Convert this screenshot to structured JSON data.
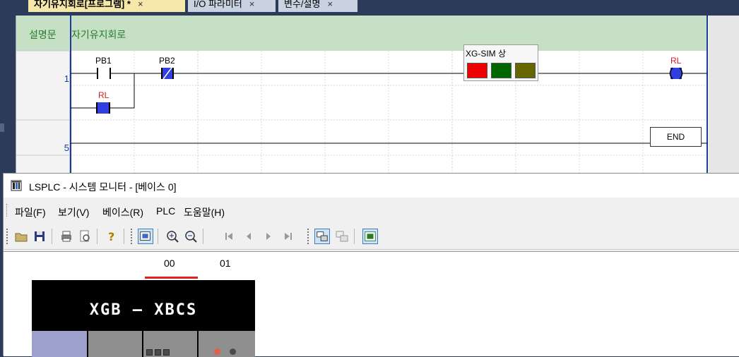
{
  "tabs": [
    {
      "label": "자기유지회로[프로그램] *",
      "active": true
    },
    {
      "label": "I/O 파라미터",
      "active": false
    },
    {
      "label": "변수/설명",
      "active": false
    }
  ],
  "tab_close_glyph": "×",
  "ladder": {
    "comment_label": "설명문",
    "comment_text": "자기유지회로",
    "rung1_number": "1",
    "rung2_number": "5",
    "contacts": [
      {
        "name": "PB1",
        "type": "NO contact",
        "state": "off"
      },
      {
        "name": "PB2",
        "type": "NC contact",
        "state": "on"
      },
      {
        "name": "RL",
        "type": "NO contact",
        "state": "on"
      }
    ],
    "coil": {
      "name": "RL",
      "state": "on"
    },
    "end_label": "END"
  },
  "sim_status": {
    "title": "XG-SIM 상",
    "leds": [
      "#ee0000",
      "#006600",
      "#666600"
    ]
  },
  "system_monitor": {
    "title": "LSPLC - 시스템 모니터 - [베이스 0]",
    "app_icon": "system-monitor-icon",
    "menu": [
      "파일(F)",
      "보기(V)",
      "베이스(R)",
      "PLC",
      "도움말(H)"
    ],
    "toolbar_icons": [
      "open-folder-icon",
      "save-icon",
      "print-icon",
      "print-preview-icon",
      "help-icon",
      "system-view-icon",
      "zoom-in-icon",
      "zoom-out-icon",
      "first-icon",
      "prev-icon",
      "next-icon",
      "last-icon",
      "plc-connect-icon",
      "plc-disconnect-icon",
      "monitor-icon"
    ],
    "slots": [
      "00",
      "01"
    ],
    "plc_model_text": "XGB — XBCS"
  }
}
